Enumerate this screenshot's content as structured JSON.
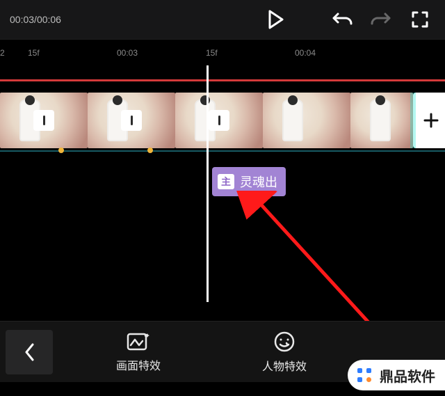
{
  "playback": {
    "current_time": "00:03",
    "total_time": "00:06"
  },
  "ruler": {
    "ticks": [
      "2",
      "15f",
      "00:03",
      "15f",
      "00:04"
    ]
  },
  "effect": {
    "badge": "主",
    "label": "灵魂出"
  },
  "bottom": {
    "picture_effects_label": "画面特效",
    "person_effects_label": "人物特效"
  },
  "watermark": {
    "text": "鼎品软件"
  },
  "colors": {
    "accent_purple": "#a284d4",
    "accent_red": "#d43a3a",
    "accent_cyan": "#2fb6c7"
  }
}
